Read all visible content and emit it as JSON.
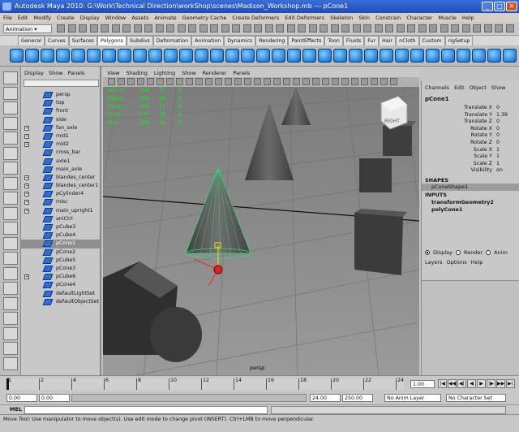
{
  "window": {
    "title": "Autodesk Maya 2010: G:\\Work\\Technical Direction\\workShop\\scenes\\Madison_Workshop.mb   ---   pCone1"
  },
  "menu": [
    "File",
    "Edit",
    "Modify",
    "Create",
    "Display",
    "Window",
    "Assets",
    "Animate",
    "Geometry Cache",
    "Create Deformers",
    "Edit Deformers",
    "Skeleton",
    "Skin",
    "Constrain",
    "Character",
    "Muscle",
    "Help"
  ],
  "mode_selector": "Animation",
  "shelf_tabs": [
    "General",
    "Curves",
    "Surfaces",
    "Polygons",
    "Subdivs",
    "Deformation",
    "Animation",
    "Dynamics",
    "Rendering",
    "PaintEffects",
    "Toon",
    "Fluids",
    "Fur",
    "Hair",
    "nCloth",
    "Custom",
    "rigSetup"
  ],
  "shelf_active_tab": "Polygons",
  "outliner": {
    "menu": [
      "Display",
      "Show",
      "Panels"
    ],
    "items": [
      {
        "label": "persp",
        "expandable": false,
        "selected": false
      },
      {
        "label": "top",
        "expandable": false,
        "selected": false
      },
      {
        "label": "front",
        "expandable": false,
        "selected": false
      },
      {
        "label": "side",
        "expandable": false,
        "selected": false
      },
      {
        "label": "fan_axle",
        "expandable": true,
        "selected": false
      },
      {
        "label": "mid1",
        "expandable": true,
        "selected": false
      },
      {
        "label": "mid2",
        "expandable": true,
        "selected": false
      },
      {
        "label": "cross_bar",
        "expandable": false,
        "selected": false
      },
      {
        "label": "axle1",
        "expandable": false,
        "selected": false
      },
      {
        "label": "main_axle",
        "expandable": false,
        "selected": false
      },
      {
        "label": "blandes_center",
        "expandable": true,
        "selected": false
      },
      {
        "label": "blandes_center1",
        "expandable": true,
        "selected": false
      },
      {
        "label": "pCylinder4",
        "expandable": true,
        "selected": false
      },
      {
        "label": "misc",
        "expandable": true,
        "selected": false
      },
      {
        "label": "main_upright1",
        "expandable": true,
        "selected": false
      },
      {
        "label": "aniCtrl",
        "expandable": false,
        "selected": false
      },
      {
        "label": "pCube3",
        "expandable": false,
        "selected": false
      },
      {
        "label": "pCube4",
        "expandable": false,
        "selected": false
      },
      {
        "label": "pCone1",
        "expandable": false,
        "selected": true
      },
      {
        "label": "pCone2",
        "expandable": false,
        "selected": false
      },
      {
        "label": "pCube5",
        "expandable": false,
        "selected": false
      },
      {
        "label": "pCone3",
        "expandable": false,
        "selected": false
      },
      {
        "label": "pCube6",
        "expandable": true,
        "selected": false
      },
      {
        "label": "pCone4",
        "expandable": false,
        "selected": false
      },
      {
        "label": "defaultLightSet",
        "expandable": false,
        "selected": false
      },
      {
        "label": "defaultObjectSet",
        "expandable": false,
        "selected": false
      }
    ]
  },
  "viewport": {
    "menu": [
      "View",
      "Shading",
      "Lighting",
      "Show",
      "Renderer",
      "Panels"
    ],
    "hud": [
      {
        "label": "Verts:",
        "a": "164",
        "b": "21",
        "c": "0"
      },
      {
        "label": "Edges:",
        "a": "290",
        "b": "40",
        "c": "0"
      },
      {
        "label": "Faces:",
        "a": "143",
        "b": "21",
        "c": "0"
      },
      {
        "label": "Tris:",
        "a": "270",
        "b": "38",
        "c": "0"
      },
      {
        "label": "UVs:",
        "a": "300",
        "b": "42",
        "c": "0"
      }
    ],
    "camera_label": "persp",
    "viewcube_label": "RIGHT"
  },
  "channel_box": {
    "menu": [
      "Channels",
      "Edit",
      "Object",
      "Show"
    ],
    "object": "pCone1",
    "attributes": [
      {
        "name": "Translate X",
        "value": "0"
      },
      {
        "name": "Translate Y",
        "value": "1.39"
      },
      {
        "name": "Translate Z",
        "value": "0"
      },
      {
        "name": "Rotate X",
        "value": "0"
      },
      {
        "name": "Rotate Y",
        "value": "0"
      },
      {
        "name": "Rotate Z",
        "value": "0"
      },
      {
        "name": "Scale X",
        "value": "1"
      },
      {
        "name": "Scale Y",
        "value": "1"
      },
      {
        "name": "Scale Z",
        "value": "1"
      },
      {
        "name": "Visibility",
        "value": "on"
      }
    ],
    "shapes_header": "SHAPES",
    "shape": "pConeShape1",
    "inputs_header": "INPUTS",
    "inputs": [
      "transformGeometry2",
      "polyCone1"
    ],
    "layer_modes": [
      "Display",
      "Render",
      "Anim"
    ],
    "layer_menu": [
      "Layers",
      "Options",
      "Help"
    ]
  },
  "timeline": {
    "ticks": [
      "1",
      "2",
      "4",
      "6",
      "8",
      "10",
      "12",
      "14",
      "16",
      "18",
      "20",
      "22",
      "24"
    ],
    "current_frame": "1.00"
  },
  "range": {
    "start": "0.00",
    "range_start": "0.00",
    "range_end": "24.00",
    "end": "250.00",
    "anim_layer": "No Anim Layer",
    "character_set": "No Character Set"
  },
  "command_line": {
    "label": "MEL"
  },
  "help_line": "Move Tool: Use manipulator to move object(s). Use edit mode to change pivot (INSERT). Ctrl+LMB to move perpendicular."
}
